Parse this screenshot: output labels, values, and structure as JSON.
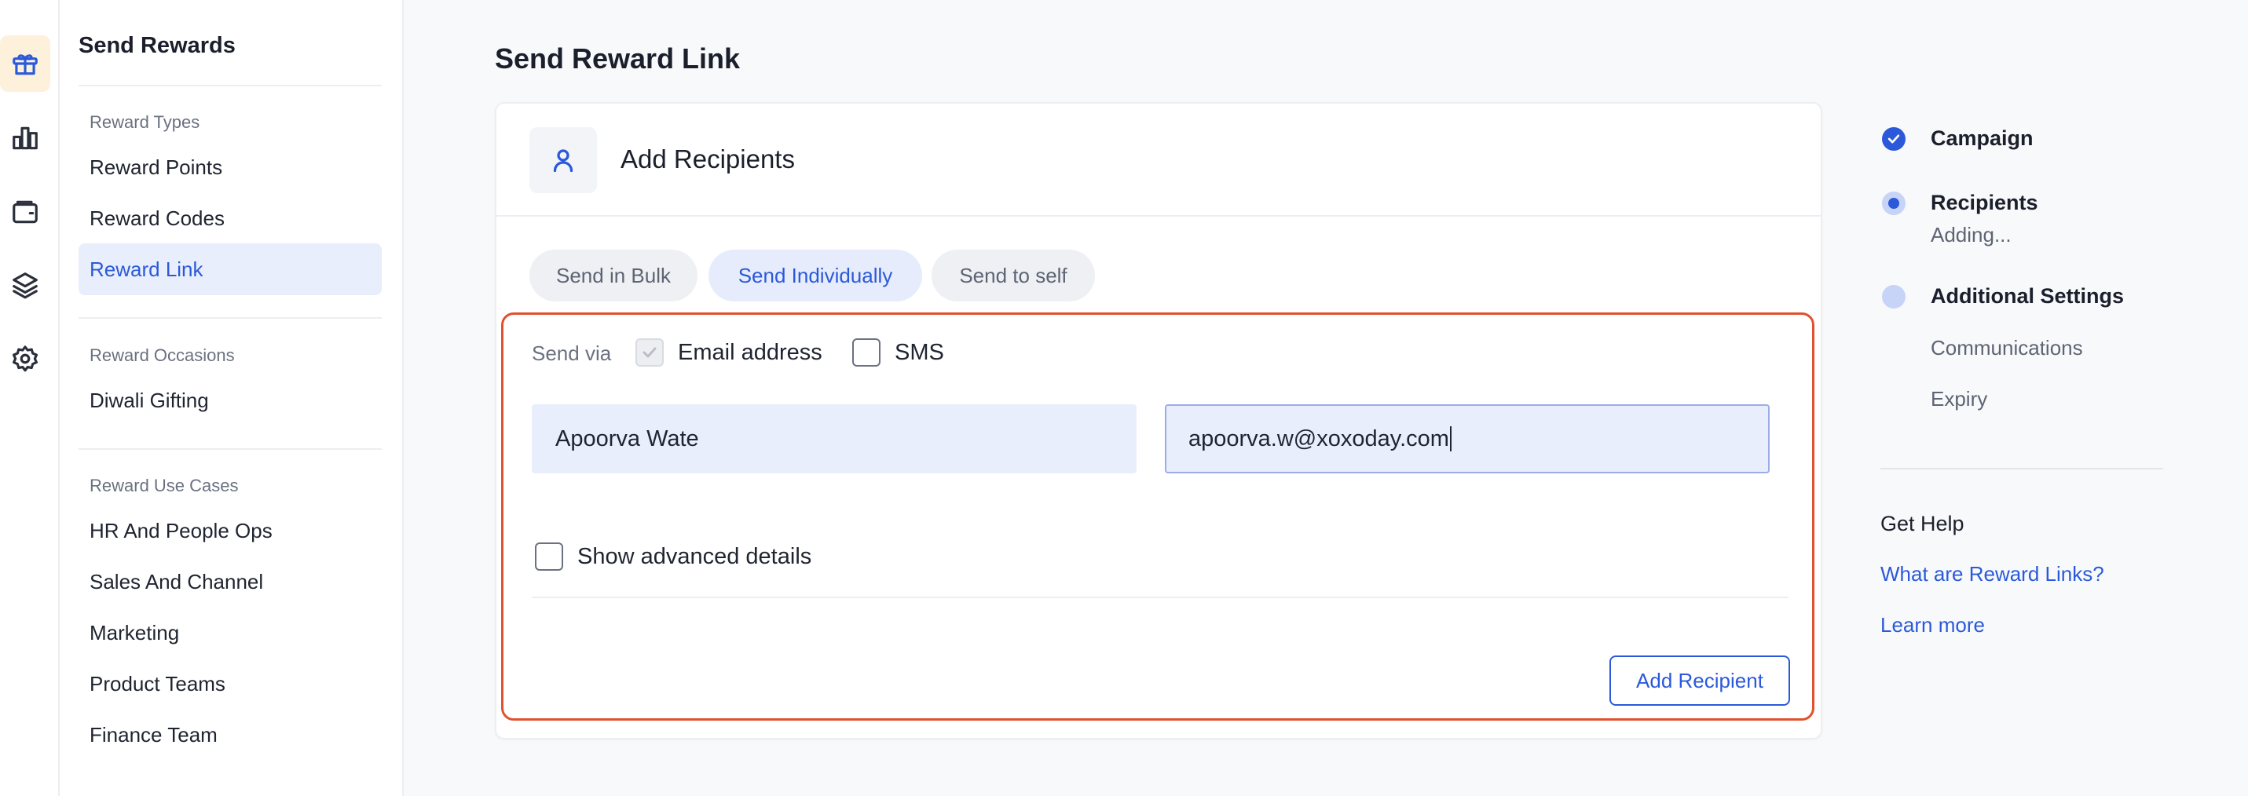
{
  "rail": {
    "icons": [
      "gift-icon",
      "bar-chart-icon",
      "wallet-icon",
      "layers-icon",
      "gear-icon"
    ]
  },
  "sidebar": {
    "title": "Send Rewards",
    "sections": [
      {
        "label": "Reward Types",
        "items": [
          "Reward Points",
          "Reward Codes",
          "Reward Link"
        ]
      },
      {
        "label": "Reward Occasions",
        "items": [
          "Diwali Gifting"
        ]
      },
      {
        "label": "Reward Use Cases",
        "items": [
          "HR And People Ops",
          "Sales And Channel",
          "Marketing",
          "Product Teams",
          "Finance Team"
        ]
      }
    ],
    "active_item": "Reward Link"
  },
  "main": {
    "page_title": "Send Reward Link",
    "card_title": "Add Recipients",
    "tabs": [
      "Send in Bulk",
      "Send Individually",
      "Send to self"
    ],
    "active_tab": "Send Individually",
    "form": {
      "send_via_label": "Send via",
      "email_label": "Email address",
      "email_checked": true,
      "sms_label": "SMS",
      "sms_checked": false,
      "name_value": "Apoorva Wate",
      "email_value": "apoorva.w@xoxoday.com",
      "advanced_label": "Show advanced details",
      "advanced_checked": false,
      "add_button": "Add Recipient"
    }
  },
  "stepper": {
    "steps": [
      {
        "title": "Campaign",
        "status": "done"
      },
      {
        "title": "Recipients",
        "status": "current",
        "subtitle": "Adding..."
      },
      {
        "title": "Additional Settings",
        "status": "todo",
        "subitems": [
          "Communications",
          "Expiry"
        ]
      }
    ]
  },
  "help": {
    "title": "Get Help",
    "links": [
      "What are Reward Links?",
      "Learn more"
    ]
  },
  "colors": {
    "accent": "#2b59d9",
    "highlight_border": "#e0512f",
    "active_bg": "#e8eefc"
  }
}
